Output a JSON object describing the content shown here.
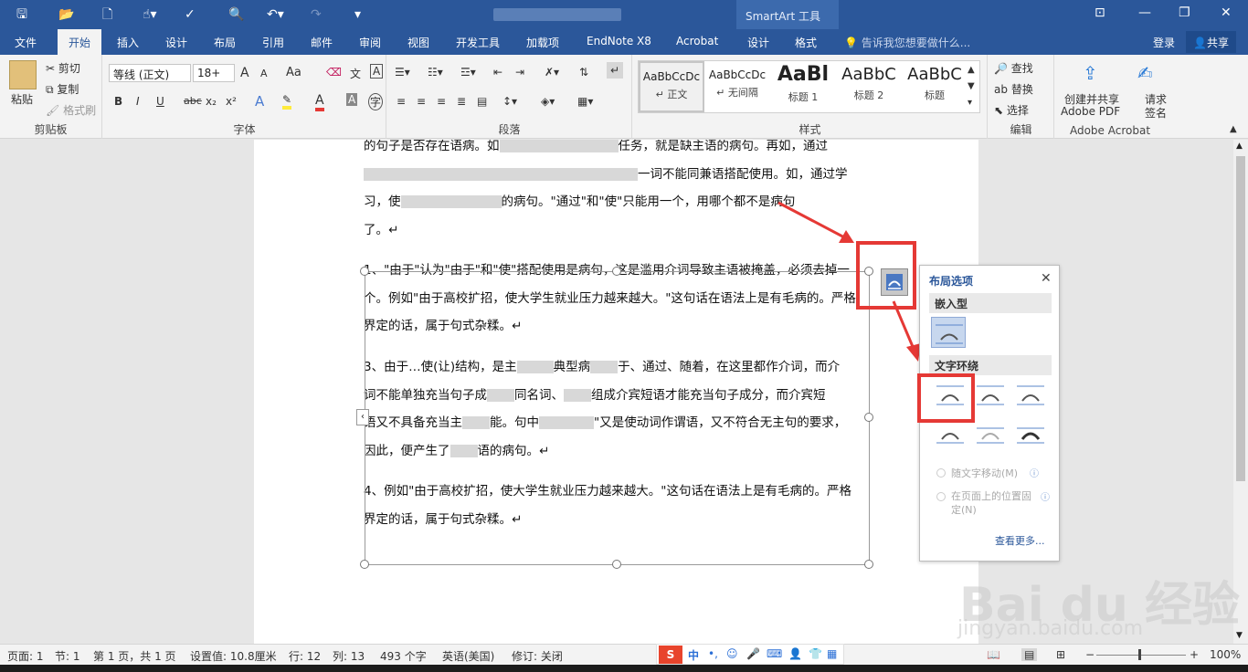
{
  "qat": {
    "save_icon": "save-icon",
    "open_icon": "open-folder-icon",
    "new_icon": "new-doc-icon",
    "touch_icon": "touch-mode-icon",
    "spell_icon": "spell-check-icon",
    "preview_icon": "print-preview-icon",
    "undo_icon": "undo-icon",
    "redo_icon": "redo-icon",
    "customize_icon": "customize-icon"
  },
  "contextual": {
    "label": "SmartArt 工具"
  },
  "window": {
    "restore_ribbon": "⊡",
    "minimize": "—",
    "maximize": "❐",
    "close": "✕"
  },
  "tabs": [
    "文件",
    "开始",
    "插入",
    "设计",
    "布局",
    "引用",
    "邮件",
    "审阅",
    "视图",
    "开发工具",
    "加载项",
    "EndNote X8",
    "Acrobat",
    "设计",
    "格式"
  ],
  "tellme": "告诉我您想要做什么...",
  "login": "登录",
  "share": "共享",
  "ribbon": {
    "clipboard": {
      "paste": "粘贴",
      "cut": "剪切",
      "copy": "复制",
      "format_painter": "格式刷",
      "label": "剪贴板"
    },
    "font": {
      "family": "等线 (正文)",
      "size": "18+",
      "grow": "A",
      "shrink": "A",
      "case": "Aa",
      "bold": "B",
      "italic": "I",
      "underline": "U",
      "strike": "abc",
      "sub": "x₂",
      "sup": "x²",
      "label": "字体"
    },
    "paragraph": {
      "label": "段落"
    },
    "styles": {
      "items": [
        {
          "preview": "AaBbCcDc",
          "name": "↵ 正文"
        },
        {
          "preview": "AaBbCcDc",
          "name": "↵ 无间隔"
        },
        {
          "preview": "AaBl",
          "name": "标题 1"
        },
        {
          "preview": "AaBbC",
          "name": "标题 2"
        },
        {
          "preview": "AaBbC",
          "name": "标题"
        }
      ],
      "label": "样式"
    },
    "editing": {
      "find": "查找",
      "replace": "替换",
      "select": "选择",
      "label": "编辑"
    },
    "acrobat": {
      "create": "创建并共享",
      "create2": "Adobe PDF",
      "sign": "请求",
      "sign2": "签名",
      "label": "Adobe Acrobat"
    }
  },
  "doc": {
    "p0": [
      "的句子是否存在语病。如",
      "任务，就是缺主语的病句。再如，通过",
      "一词不能同兼语搭配使用。如，通过学",
      "习，使",
      "的病句。\"通过\"和\"使\"只能用一个，用哪个都不是病句",
      "了。↵"
    ],
    "p1": [
      "1、\"由于\"认为\"由于\"和\"使\"搭配使用是病句，这是滥用介词导致主语被掩盖，必须去掉一",
      "个。例如\"由于高校扩招，使大学生就业压力越来越大。\"这句话在语法上是有毛病的。严格",
      "界定的话，属于句式杂糅。↵"
    ],
    "p2": [
      "3、由于…使(让)结构，是主",
      "典型病",
      "于、通过、随着，在这里都作介词，而介",
      "词不能单独充当句子成",
      "同名词、",
      "组成介宾短语才能充当句子成分，而介宾短",
      "语又不具备充当主",
      "能。句中",
      "\"又是使动词作谓语，又不符合无主句的要求，",
      "因此，便产生了",
      "语的病句。↵"
    ],
    "p3": [
      "4、例如\"由于高校扩招，使大学生就业压力越来越大。\"这句话在语法上是有毛病的。严格",
      "界定的话，属于句式杂糅。↵"
    ]
  },
  "layout_options": {
    "title": "布局选项",
    "inline": "嵌入型",
    "wrap": "文字环绕",
    "move_with_text": "随文字移动(M)",
    "fix_position": "在页面上的位置固定(N)",
    "see_more": "查看更多..."
  },
  "status": {
    "page": "页面: 1",
    "section": "节: 1",
    "pages": "第 1 页，共 1 页",
    "setting": "设置值: 10.8厘米",
    "row": "行: 12",
    "col": "列: 13",
    "words": "493 个字",
    "lang": "英语(美国)",
    "track": "修订: 关闭",
    "zoom": "100%"
  },
  "ime": {
    "brand": "S",
    "mode": "中"
  },
  "watermark": {
    "logo": "Bai du 经验",
    "url": "jingyan.baidu.com"
  },
  "colors": {
    "accent": "#2b579a",
    "highlight": "#e53935"
  }
}
